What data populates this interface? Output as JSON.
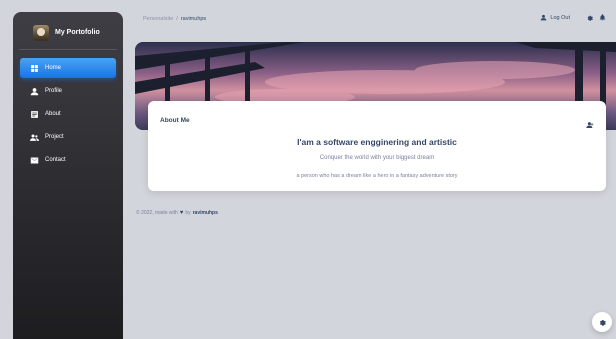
{
  "sidebar": {
    "brand": "My Portofolio",
    "items": [
      {
        "label": "Home",
        "icon": "home-icon",
        "active": true
      },
      {
        "label": "Profile",
        "icon": "person-icon",
        "active": false
      },
      {
        "label": "About",
        "icon": "article-icon",
        "active": false
      },
      {
        "label": "Project",
        "icon": "group-icon",
        "active": false
      },
      {
        "label": "Contact",
        "icon": "mail-icon",
        "active": false
      }
    ]
  },
  "header": {
    "breadcrumb_root": "Personalsite",
    "breadcrumb_sep": "/",
    "breadcrumb_current": "ravimuhps",
    "logout_label": "Log Out"
  },
  "card": {
    "title": "About Me",
    "headline": "I'am a software engginering and artistic",
    "subline": "Conquer the world with your biggest dream",
    "description": "a person who has a dream like a hero in a fantasy adventure story"
  },
  "footer": {
    "prefix": "© 2022, made with",
    "heart": "♥",
    "by": "by",
    "author": "ravimuhps"
  },
  "colors": {
    "accent": "#1A73E8",
    "sidebar_dark": "#1d1d20",
    "background": "#d2d5db",
    "text": "#344767"
  }
}
